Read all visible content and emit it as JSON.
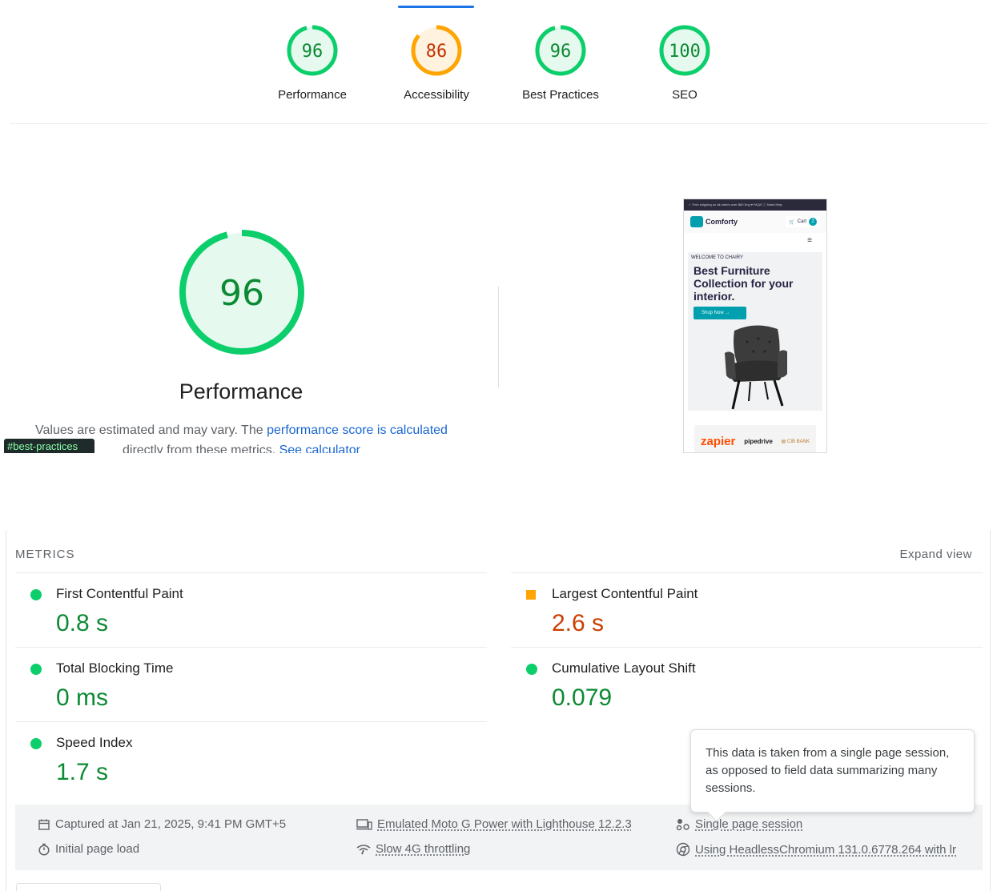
{
  "gauges": [
    {
      "score": "96",
      "label": "Performance",
      "color": "#0cce6b",
      "fill": "#e6f9ef",
      "text_color": "#0c8a33",
      "fraction": 0.96
    },
    {
      "score": "86",
      "label": "Accessibility",
      "color": "#ffa400",
      "fill": "#fff3e0",
      "text_color": "#c33300",
      "fraction": 0.86
    },
    {
      "score": "96",
      "label": "Best Practices",
      "color": "#0cce6b",
      "fill": "#e6f9ef",
      "text_color": "#0c8a33",
      "fraction": 0.96
    },
    {
      "score": "100",
      "label": "SEO",
      "color": "#0cce6b",
      "fill": "#e6f9ef",
      "text_color": "#0c8a33",
      "fraction": 1.0
    }
  ],
  "performance": {
    "score": "96",
    "fraction": 0.96,
    "title": "Performance",
    "desc_prefix": "Values are estimated and may vary. The ",
    "desc_link": "performance score is calculated",
    "desc_middle": "directly from these metrics. ",
    "desc_link2": "See calculator",
    "anchor_badge": "#best-practices"
  },
  "thumbnail": {
    "topbar": "✓ Free shipping on all orders over $50          Eng ▾  FAQS  ⓘ Need Help",
    "logo": "Comforty",
    "cart_label": "Cart",
    "cart_count": "2",
    "menu_icon": "≡",
    "welcome": "WELCOME TO CHAIRY",
    "headline": "Best Furniture Collection for your interior.",
    "shop_btn": "Shop Now  →",
    "brands": [
      "zapier",
      "pipedrive",
      "▤ CIB BANK"
    ]
  },
  "metrics": {
    "title": "METRICS",
    "expand": "Expand view",
    "items": [
      {
        "name": "First Contentful Paint",
        "value": "0.8 s",
        "rating": "pass"
      },
      {
        "name": "Largest Contentful Paint",
        "value": "2.6 s",
        "rating": "average"
      },
      {
        "name": "Total Blocking Time",
        "value": "0 ms",
        "rating": "pass"
      },
      {
        "name": "Cumulative Layout Shift",
        "value": "0.079",
        "rating": "pass"
      },
      {
        "name": "Speed Index",
        "value": "1.7 s",
        "rating": "pass"
      }
    ]
  },
  "runtime": {
    "captured": "Captured at Jan 21, 2025, 9:41 PM GMT+5",
    "initial_load": "Initial page load",
    "device": "Emulated Moto G Power with Lighthouse 12.2.3",
    "throttling": "Slow 4G throttling",
    "session": "Single page session",
    "browser": "Using HeadlessChromium 131.0.6778.264 with lr"
  },
  "tooltip": {
    "text": "This data is taken from a single page session, as opposed to field data summarizing many sessions."
  }
}
